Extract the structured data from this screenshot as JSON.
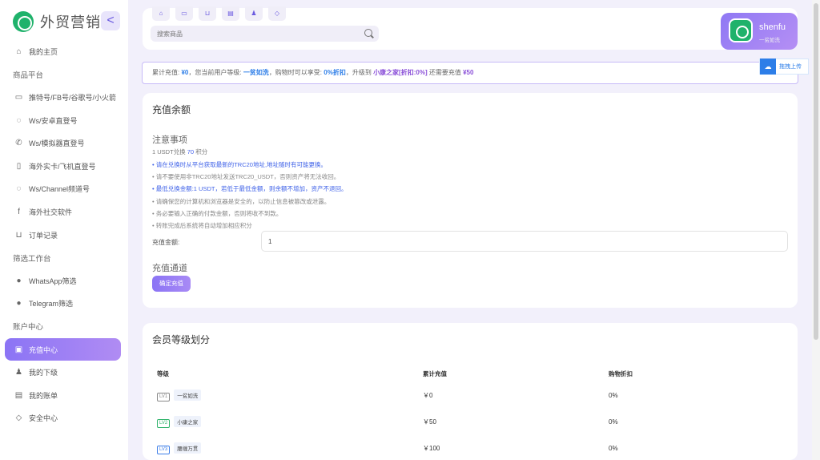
{
  "brand": {
    "name": "外贸营销",
    "collapse": "<"
  },
  "sidebar": {
    "items": [
      {
        "type": "item",
        "icon": "home-icon",
        "glyph": "⌂",
        "label": "我的主页",
        "active": false
      },
      {
        "type": "header",
        "label": "商品平台"
      },
      {
        "type": "item",
        "icon": "chat-icon",
        "glyph": "▭",
        "label": "推特号/FB号/谷歌号/小火箭",
        "active": false
      },
      {
        "type": "item",
        "icon": "whatsapp-icon",
        "glyph": "◌",
        "label": "Ws/安卓直登号",
        "active": false
      },
      {
        "type": "item",
        "icon": "phone-icon",
        "glyph": "✆",
        "label": "Ws/模拟器直登号",
        "active": false
      },
      {
        "type": "item",
        "icon": "sim-card-icon",
        "glyph": "▯",
        "label": "海外实卡/飞机直登号",
        "active": false
      },
      {
        "type": "item",
        "icon": "whatsapp-icon",
        "glyph": "◌",
        "label": "Ws/Channel频道号",
        "active": false
      },
      {
        "type": "item",
        "icon": "facebook-icon",
        "glyph": "f",
        "label": "海外社交软件",
        "active": false
      },
      {
        "type": "item",
        "icon": "cart-icon",
        "glyph": "⊔",
        "label": "订单记录",
        "active": false
      },
      {
        "type": "header",
        "label": "筛选工作台"
      },
      {
        "type": "item",
        "icon": "whatsapp-icon",
        "glyph": "●",
        "label": "WhatsApp筛选",
        "active": false
      },
      {
        "type": "item",
        "icon": "telegram-icon",
        "glyph": "●",
        "label": "Telegram筛选",
        "active": false
      },
      {
        "type": "header",
        "label": "账户中心"
      },
      {
        "type": "item",
        "icon": "wallet-icon",
        "glyph": "▣",
        "label": "充值中心",
        "active": true
      },
      {
        "type": "item",
        "icon": "user-icon",
        "glyph": "♟",
        "label": "我的下级",
        "active": false
      },
      {
        "type": "item",
        "icon": "bill-icon",
        "glyph": "▤",
        "label": "我的账单",
        "active": false
      },
      {
        "type": "item",
        "icon": "shield-icon",
        "glyph": "◇",
        "label": "安全中心",
        "active": false
      }
    ]
  },
  "topbar": {
    "tabs": [
      {
        "icon": "home-icon",
        "glyph": "⌂"
      },
      {
        "icon": "card-icon",
        "glyph": "▭"
      },
      {
        "icon": "cart-icon",
        "glyph": "⊔"
      },
      {
        "icon": "doc-icon",
        "glyph": "▤"
      },
      {
        "icon": "user-icon",
        "glyph": "♟"
      },
      {
        "icon": "shield-icon",
        "glyph": "◇"
      }
    ],
    "search_placeholder": "搜索商品"
  },
  "user": {
    "name": "shenfu",
    "level": "一贫如洗"
  },
  "upload": {
    "label": "拖拽上传"
  },
  "notice": {
    "p1": "累计充值: ",
    "total": "¥0",
    "p2": "，您当前用户等级: ",
    "level": "一贫如洗",
    "p3": "，购物时可以享受: ",
    "discount": "0%折扣",
    "p4": "，升级到 ",
    "next_level": "小康之家[折扣:0%]",
    "p5": " 还需要充值 ",
    "need": "¥50"
  },
  "recharge": {
    "title": "充值余额",
    "notes_title": "注意事项",
    "rate_prefix": "1 USDT兑换 ",
    "rate_value": "70",
    "rate_suffix": " 积分",
    "rules": [
      {
        "text": "• 请在兑换时从平台获取最新的TRC20地址,地址随时有可能更换。",
        "highlight": true
      },
      {
        "text": "• 请不要使用非TRC20地址发送TRC20_USDT，否则资产将无法收回。",
        "highlight": false
      },
      {
        "text": "• 最低兑换金额:1 USDT，若低于最低金额，则余额不增加，资产不退回。",
        "highlight": true
      },
      {
        "text": "• 请确保您的计算机和浏览器是安全的，以防止信息被篡改或泄露。",
        "highlight": false
      },
      {
        "text": "• 务必要输入正确的付款金额，否则将收不到款。",
        "highlight": false
      },
      {
        "text": "• 转账完成后系统将自动增加相应积分",
        "highlight": false
      }
    ],
    "amount_label": "充值金额:",
    "amount_value": "1",
    "channel_title": "充值通道",
    "confirm_label": "确定充值"
  },
  "levels": {
    "title": "会员等级划分",
    "headers": [
      "等级",
      "累计充值",
      "购物折扣"
    ],
    "rows": [
      {
        "badge": "LV1",
        "badge_color": "#888888",
        "name": "一贫如洗",
        "total": "￥0",
        "discount": "0%"
      },
      {
        "badge": "LV2",
        "badge_color": "#2fb36b",
        "name": "小康之家",
        "total": "￥50",
        "discount": "0%"
      },
      {
        "badge": "LV3",
        "badge_color": "#3f7fe8",
        "name": "腰缠万贯",
        "total": "￥100",
        "discount": "0%"
      }
    ]
  }
}
